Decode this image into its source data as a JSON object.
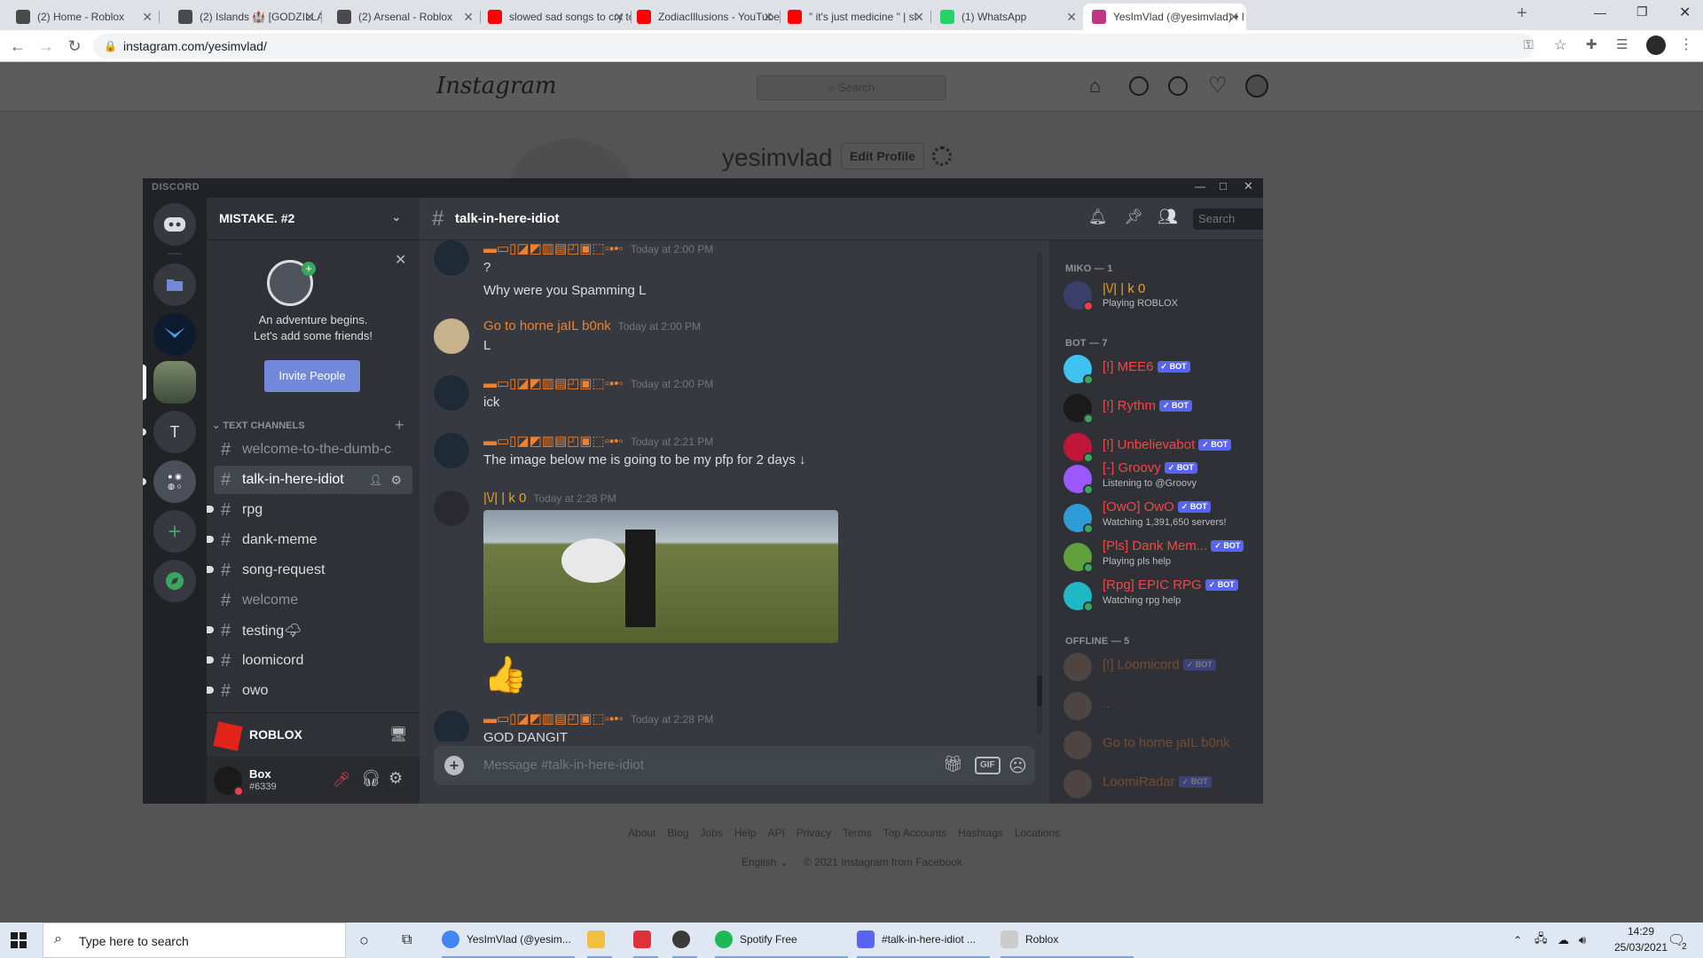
{
  "browser": {
    "tabs": [
      {
        "title": "(2) Home - Roblox",
        "color": "#4a4a4a"
      },
      {
        "title": "(2) Islands 🏰 [GODZILLA V",
        "color": "#4a4a4a"
      },
      {
        "title": "(2) Arsenal - Roblox",
        "color": "#4a4a4a"
      },
      {
        "title": "slowed sad songs to cry to :(",
        "color": "#ff0000"
      },
      {
        "title": "ZodiacIllusions - YouTube",
        "color": "#ff0000"
      },
      {
        "title": "\" it's just medicine \" | sl",
        "color": "#ff0000"
      },
      {
        "title": "(1) WhatsApp",
        "color": "#25d366"
      },
      {
        "title": "YesImVlad (@yesimvlad) • I",
        "color": "#c13584"
      }
    ],
    "url": "instagram.com/yesimvlad/"
  },
  "instagram": {
    "logo": "Instagram",
    "search_placeholder": "Search",
    "username": "yesimvlad",
    "edit_profile": "Edit Profile",
    "footer_links": [
      "About",
      "Blog",
      "Jobs",
      "Help",
      "API",
      "Privacy",
      "Terms",
      "Top Accounts",
      "Hashtags",
      "Locations"
    ],
    "language": "English",
    "copyright": "© 2021 Instagram from Facebook"
  },
  "discord": {
    "app_name": "DISCORD",
    "server_name": "MISTAKE. #2",
    "guild_letter": "T",
    "welcome_line1": "An adventure begins.",
    "welcome_line2": "Let's add some friends!",
    "invite_button": "Invite People",
    "category": "TEXT CHANNELS",
    "channels": [
      {
        "name": "welcome-to-the-dumb-c...",
        "state": "muted"
      },
      {
        "name": "talk-in-here-idiot",
        "state": "selected"
      },
      {
        "name": "rpg",
        "state": "unread"
      },
      {
        "name": "dank-meme",
        "state": "unread"
      },
      {
        "name": "song-request",
        "state": "unread"
      },
      {
        "name": "welcome",
        "state": "muted"
      },
      {
        "name": "testing🌩",
        "state": "unread"
      },
      {
        "name": "loomicord",
        "state": "unread"
      },
      {
        "name": "owo",
        "state": "unread"
      }
    ],
    "activity_game": "ROBLOX",
    "user": {
      "name": "Box",
      "tag": "#6339"
    },
    "channel_title": "talk-in-here-idiot",
    "search_placeholder": "Search",
    "message_placeholder": "Message #talk-in-here-idiot",
    "gif_label": "GIF",
    "messages": [
      {
        "author": "▬▭▯◪◩▥▤◰▣⬚▫▪•◦",
        "time": "Today at 2:00 PM",
        "lines": [
          "?",
          "Why were you Spamming L"
        ],
        "author_color": "#f0802e"
      },
      {
        "author": "Go to horne jaIL b0nk",
        "time": "Today at 2:00 PM",
        "lines": [
          "L"
        ],
        "author_color": "#f0802e"
      },
      {
        "author": "▬▭▯◪◩▥▤◰▣⬚▫▪•◦",
        "time": "Today at 2:00 PM",
        "lines": [
          "ick"
        ],
        "author_color": "#f0802e"
      },
      {
        "author": "▬▭▯◪◩▥▤◰▣⬚▫▪•◦",
        "time": "Today at 2:21 PM",
        "lines": [
          "The image below me is going to be my pfp for 2 days ↓"
        ],
        "author_color": "#f0802e"
      },
      {
        "author": "|\\/| | k 0",
        "time": "Today at 2:28 PM",
        "lines": [],
        "author_color": "#f0a020"
      },
      {
        "author": "▬▭▯◪◩▥▤◰▣⬚▫▪•◦",
        "time": "Today at 2:28 PM",
        "lines": [
          "GOD DANGIT"
        ],
        "author_color": "#f0802e"
      }
    ],
    "reaction_emoji": "👍",
    "members": {
      "miko_header": "MIKO — 1",
      "bot_header": "BOT — 7",
      "offline_header": "OFFLINE — 5",
      "bot_tag": "✓ BOT",
      "miko": [
        {
          "name": "|\\/| | k 0",
          "status": "Playing ROBLOX",
          "color": "#f0a020"
        }
      ],
      "bots": [
        {
          "name": "[!] MEE6",
          "status": "",
          "color": "#f04747",
          "av": "#3ec3f0"
        },
        {
          "name": "[!] Rythm",
          "status": "",
          "color": "#f04747",
          "av": "#1a1a1a"
        },
        {
          "name": "[!] Unbelievabot",
          "status": "",
          "color": "#f04747",
          "av": "#c0163a"
        },
        {
          "name": "[-] Groovy",
          "status": "Listening to @Groovy",
          "color": "#f04747",
          "av": "#9b59ff"
        },
        {
          "name": "[OwO] OwO",
          "status": "Watching 1,391,650 servers!",
          "color": "#f04747",
          "av": "#2e9cd6"
        },
        {
          "name": "[Pls] Dank Mem...",
          "status": "Playing pls help",
          "color": "#f04747",
          "av": "#5fa03c"
        },
        {
          "name": "[Rpg] EPIC RPG",
          "status": "Watching rpg help",
          "color": "#f04747",
          "av": "#1fb8c4"
        }
      ],
      "offline": [
        {
          "name": "[!] Loomicord",
          "bot": true
        },
        {
          "name": "..",
          "bot": false
        },
        {
          "name": "Go to horne jaIL b0nk",
          "bot": false
        },
        {
          "name": "LoomiRadar",
          "bot": true
        }
      ]
    }
  },
  "taskbar": {
    "search_placeholder": "Type here to search",
    "apps": [
      {
        "label": "YesImVlad (@yesim...",
        "color": "#4285f4"
      },
      {
        "label": "",
        "color": "#f0c040"
      },
      {
        "label": "",
        "color": "#e0303a"
      },
      {
        "label": "",
        "color": "#3a3a3a"
      },
      {
        "label": "Spotify Free",
        "color": "#1db954"
      },
      {
        "label": "#talk-in-here-idiot ...",
        "color": "#5865f2"
      },
      {
        "label": "Roblox",
        "color": "#cccccc"
      }
    ],
    "time": "14:29",
    "date": "25/03/2021",
    "notif_count": "2"
  }
}
